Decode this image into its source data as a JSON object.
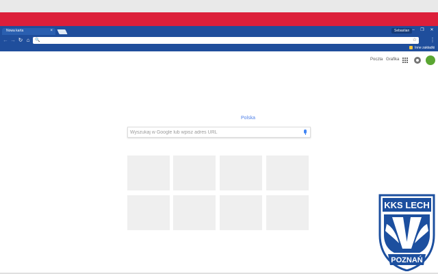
{
  "tab": {
    "title": "Nowa karta",
    "close_glyph": "×"
  },
  "profile": {
    "name": "Sebastian"
  },
  "window_controls": {
    "minimize": "–",
    "restore": "❐",
    "close": "✕"
  },
  "toolbar": {
    "back": "←",
    "forward": "→",
    "reload": "↻",
    "home": "⌂",
    "star": "☆",
    "menu": "⋮",
    "search_glyph": "🔍"
  },
  "bookmarks": {
    "other": "Inne zakładki"
  },
  "gbar": {
    "mail": "Poczta",
    "images": "Grafika"
  },
  "ntp": {
    "region": "Polska",
    "search_placeholder": "Wyszukaj w Google lub wpisz adres URL",
    "tile_count": 8
  },
  "theme": {
    "chrome_color": "#1f4e9c",
    "band_color": "#dc1f3a",
    "crest_color": "#1c4f9f",
    "crest_text_top": "KKS LECH",
    "crest_text_bottom": "POZNAŃ"
  }
}
